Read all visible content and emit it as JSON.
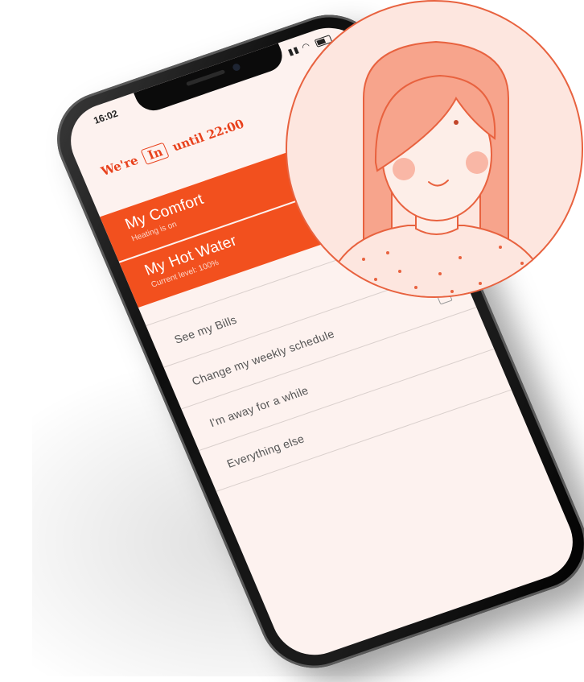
{
  "status_bar": {
    "time": "16:02"
  },
  "header": {
    "presence_prefix": "We're",
    "presence_state": "In",
    "presence_suffix": "until 22:00"
  },
  "cards": [
    {
      "title": "My Comfort",
      "subtitle": "Heating is on"
    },
    {
      "title": "My Hot Water",
      "subtitle": "Current level: 100%"
    }
  ],
  "menu": {
    "items": [
      {
        "label": "See my Bills",
        "icon": "bills-icon"
      },
      {
        "label": "Change my weekly schedule",
        "icon": "calendar-icon"
      },
      {
        "label": "I'm away for a while",
        "icon": ""
      },
      {
        "label": "Everything else",
        "icon": ""
      }
    ]
  },
  "colors": {
    "accent": "#f2501e",
    "screen_bg": "#fdf2ef",
    "avatar_bg": "#fde6df",
    "hair": "#f7a48c"
  }
}
